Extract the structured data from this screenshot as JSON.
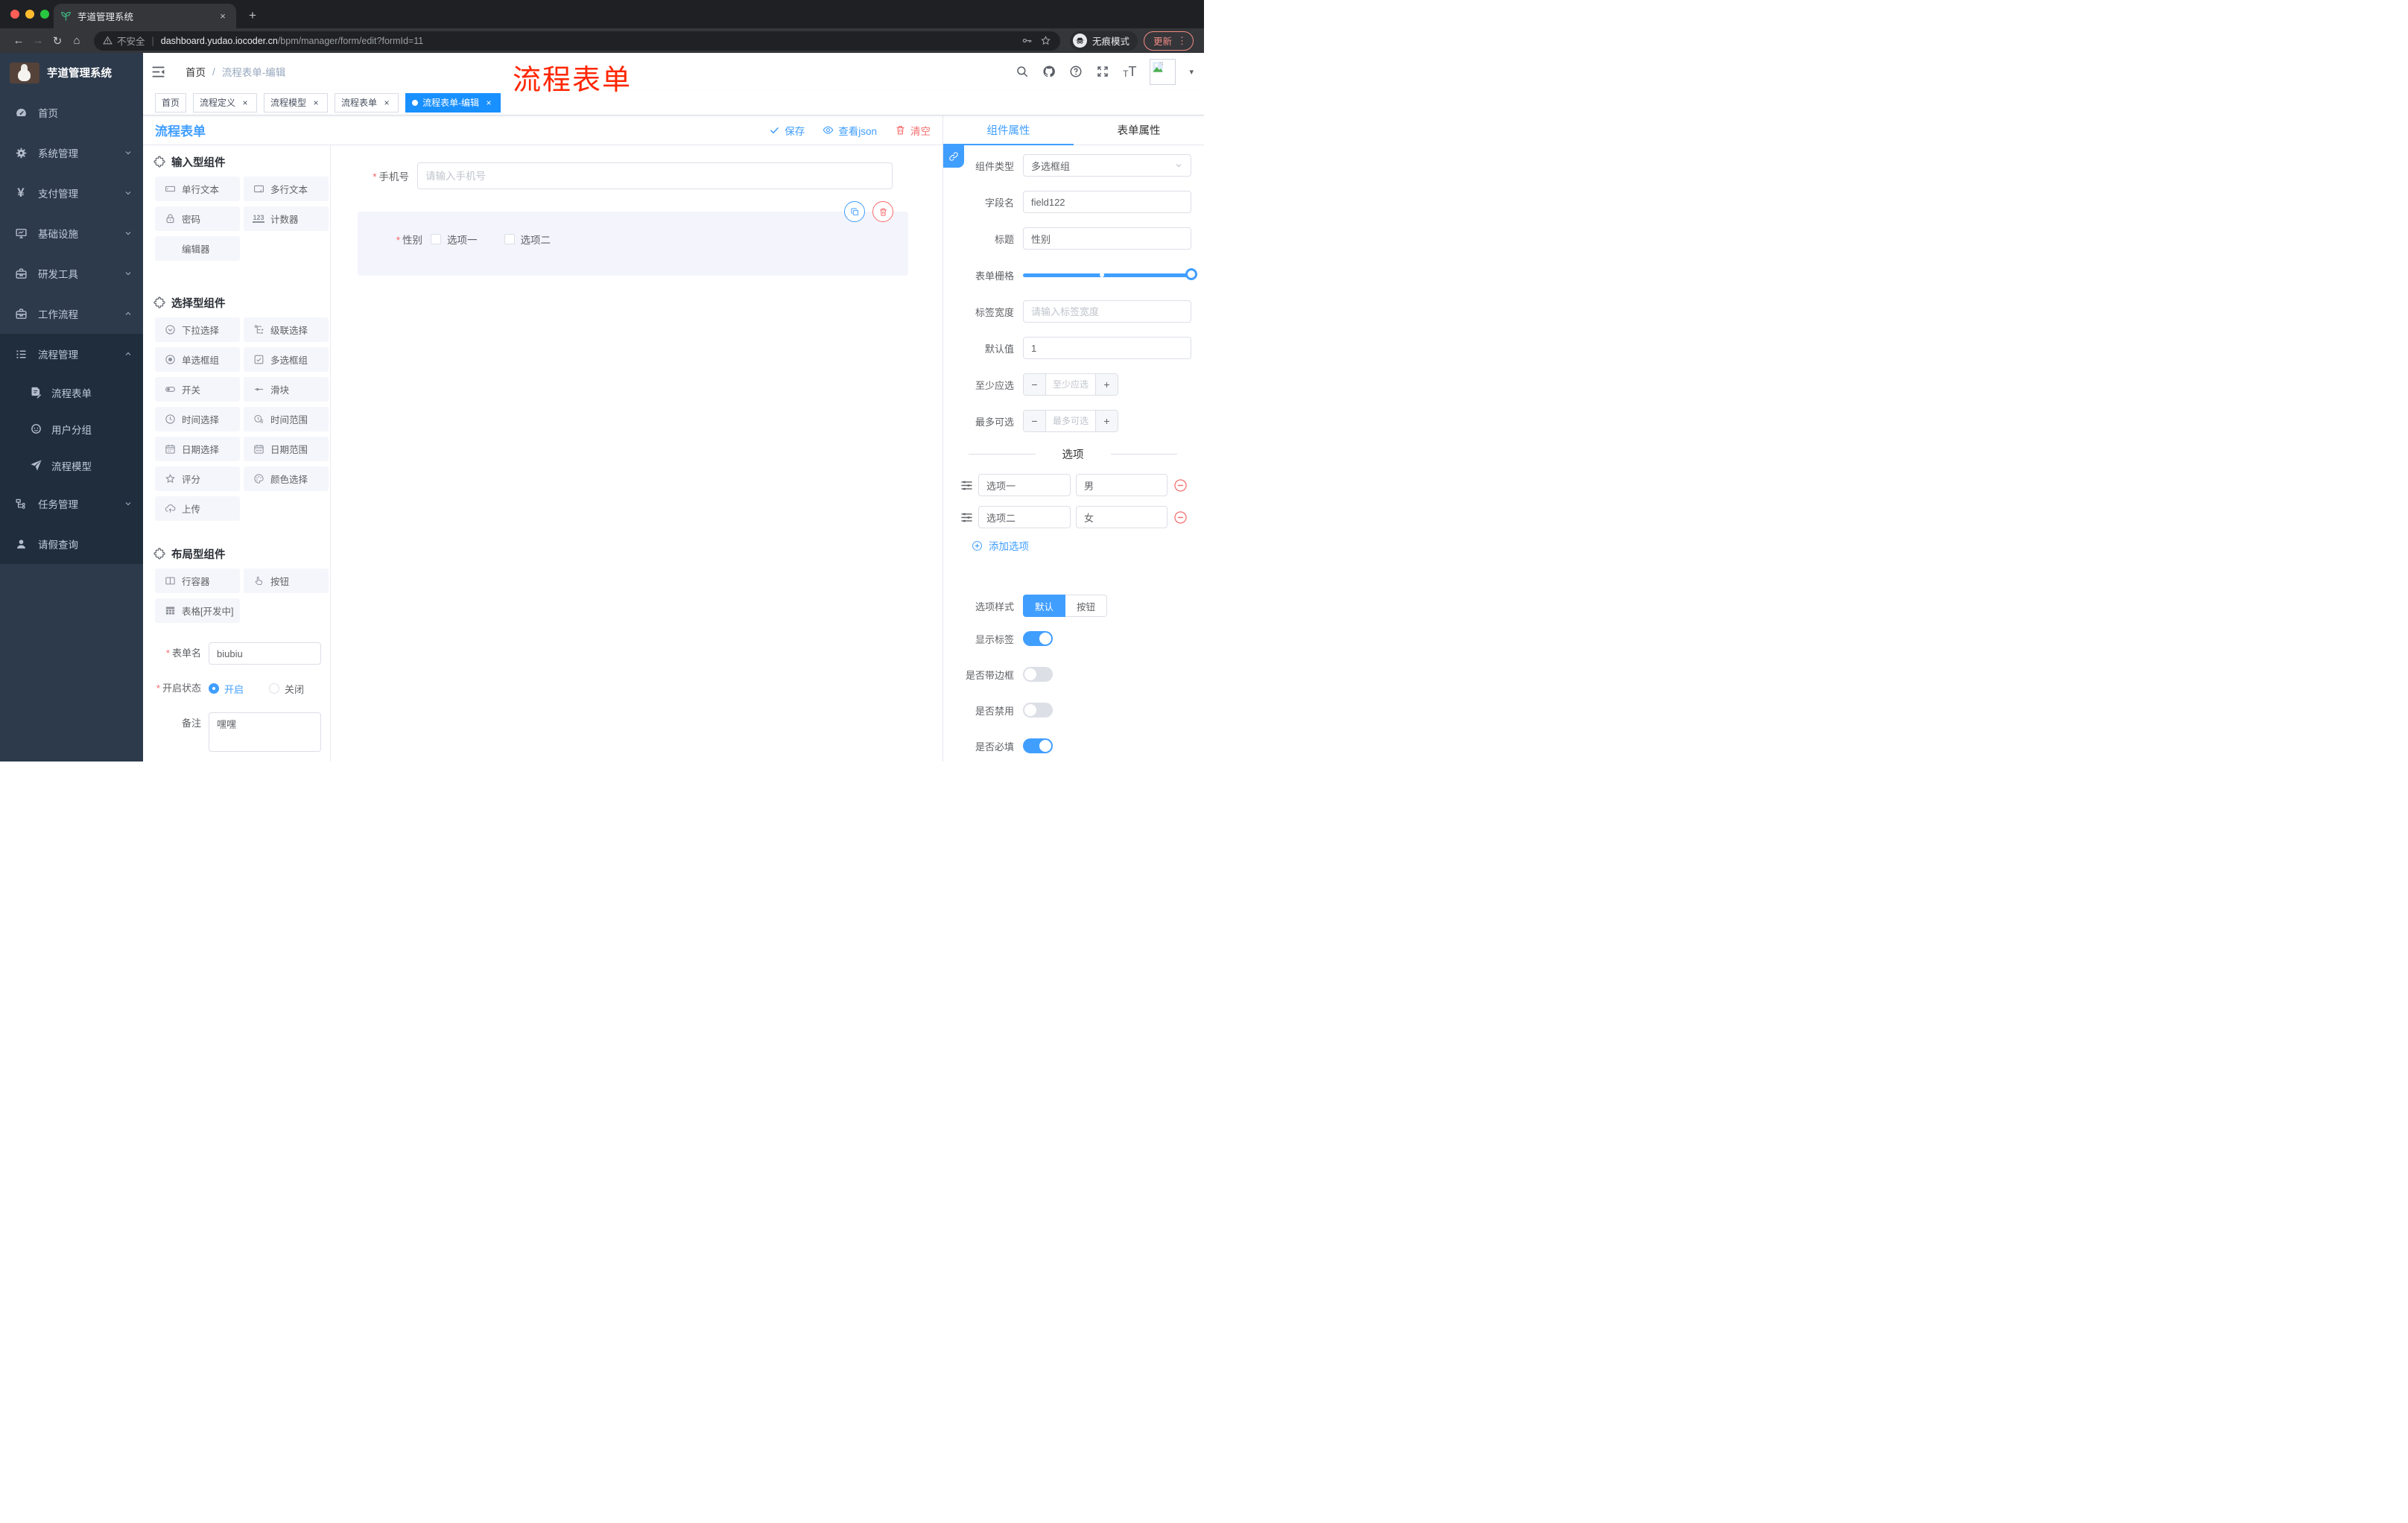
{
  "glyphs": {
    "close": "×",
    "plus": "+",
    "dots": "⋮",
    "divider": "|",
    "back": "←",
    "forward": "→",
    "reload": "↻",
    "home": "⌂",
    "caret": "▾",
    "minus": "−",
    "plus_small": "+",
    "yen": "¥"
  },
  "misc": {
    "required_mark": "*",
    "counter_glyph": "123",
    "t_small": "T",
    "t_big": "T"
  },
  "browser": {
    "tab_title": "芋道管理系统",
    "not_secure": "不安全",
    "url_domain": "dashboard.yudao.iocoder.cn",
    "url_path": "/bpm/manager/form/edit?formId=11",
    "incognito_label": "无痕模式",
    "update_label": "更新"
  },
  "sidebar": {
    "brand": "芋道管理系统",
    "home": "首页",
    "system": "系统管理",
    "payment": "支付管理",
    "infra": "基础设施",
    "devtools": "研发工具",
    "workflow": "工作流程",
    "process_mgmt": "流程管理",
    "process_form": "流程表单",
    "user_group": "用户分组",
    "process_model": "流程模型",
    "task_mgmt": "任务管理",
    "leave_query": "请假查询"
  },
  "topbar": {
    "breadcrumb_home": "首页",
    "breadcrumb_sep": "/",
    "breadcrumb_current": "流程表单-编辑",
    "overlay_title": "流程表单"
  },
  "tags": {
    "items": [
      {
        "label": "首页"
      },
      {
        "label": "流程定义"
      },
      {
        "label": "流程模型"
      },
      {
        "label": "流程表单"
      },
      {
        "label": "流程表单-编辑"
      }
    ]
  },
  "designer": {
    "title": "流程表单",
    "save": "保存",
    "view_json": "查看json",
    "clear": "清空"
  },
  "panel": {
    "input_title": "输入型组件",
    "input_items": [
      "单行文本",
      "多行文本",
      "密码",
      "计数器",
      "编辑器"
    ],
    "select_title": "选择型组件",
    "select_items": [
      "下拉选择",
      "级联选择",
      "单选框组",
      "多选框组",
      "开关",
      "滑块",
      "时间选择",
      "时间范围",
      "日期选择",
      "日期范围",
      "评分",
      "颜色选择",
      "上传"
    ],
    "layout_title": "布局型组件",
    "layout_items": [
      "行容器",
      "按钮",
      "表格[开发中]"
    ]
  },
  "meta_form": {
    "name_label": "表单名",
    "name_value": "biubiu",
    "status_label": "开启状态",
    "status_on": "开启",
    "status_off": "关闭",
    "remark_label": "备注",
    "remark_value": "嘿嘿"
  },
  "canvas": {
    "phone_label": "手机号",
    "phone_placeholder": "请输入手机号",
    "gender_label": "性别",
    "gender_opt1": "选项一",
    "gender_opt2": "选项二"
  },
  "props": {
    "tab_component": "组件属性",
    "tab_form": "表单属性",
    "type_label": "组件类型",
    "type_value": "多选框组",
    "field_label": "字段名",
    "field_value": "field122",
    "title_label": "标题",
    "title_value": "性别",
    "grid_label": "表单栅格",
    "label_width_label": "标签宽度",
    "label_width_placeholder": "请输入标签宽度",
    "default_label": "默认值",
    "default_value": "1",
    "min_label": "至少应选",
    "min_placeholder": "至少应选",
    "max_label": "最多可选",
    "max_placeholder": "最多可选",
    "options_title": "选项",
    "options": [
      {
        "label": "选项一",
        "value": "男"
      },
      {
        "label": "选项二",
        "value": "女"
      }
    ],
    "add_option": "添加选项",
    "style_label": "选项样式",
    "style_default": "默认",
    "style_button": "按钮",
    "show_label_label": "显示标签",
    "border_label": "是否带边框",
    "disabled_label": "是否禁用",
    "required_label": "是否必填"
  },
  "colors": {
    "accent": "#409eff",
    "danger": "#f56c6c",
    "active_tag": "#1890ff",
    "overlay_red": "#ff2500",
    "sidebar_bg": "#2d3a4b",
    "sidebar_sub_bg": "#1f2d3d"
  }
}
